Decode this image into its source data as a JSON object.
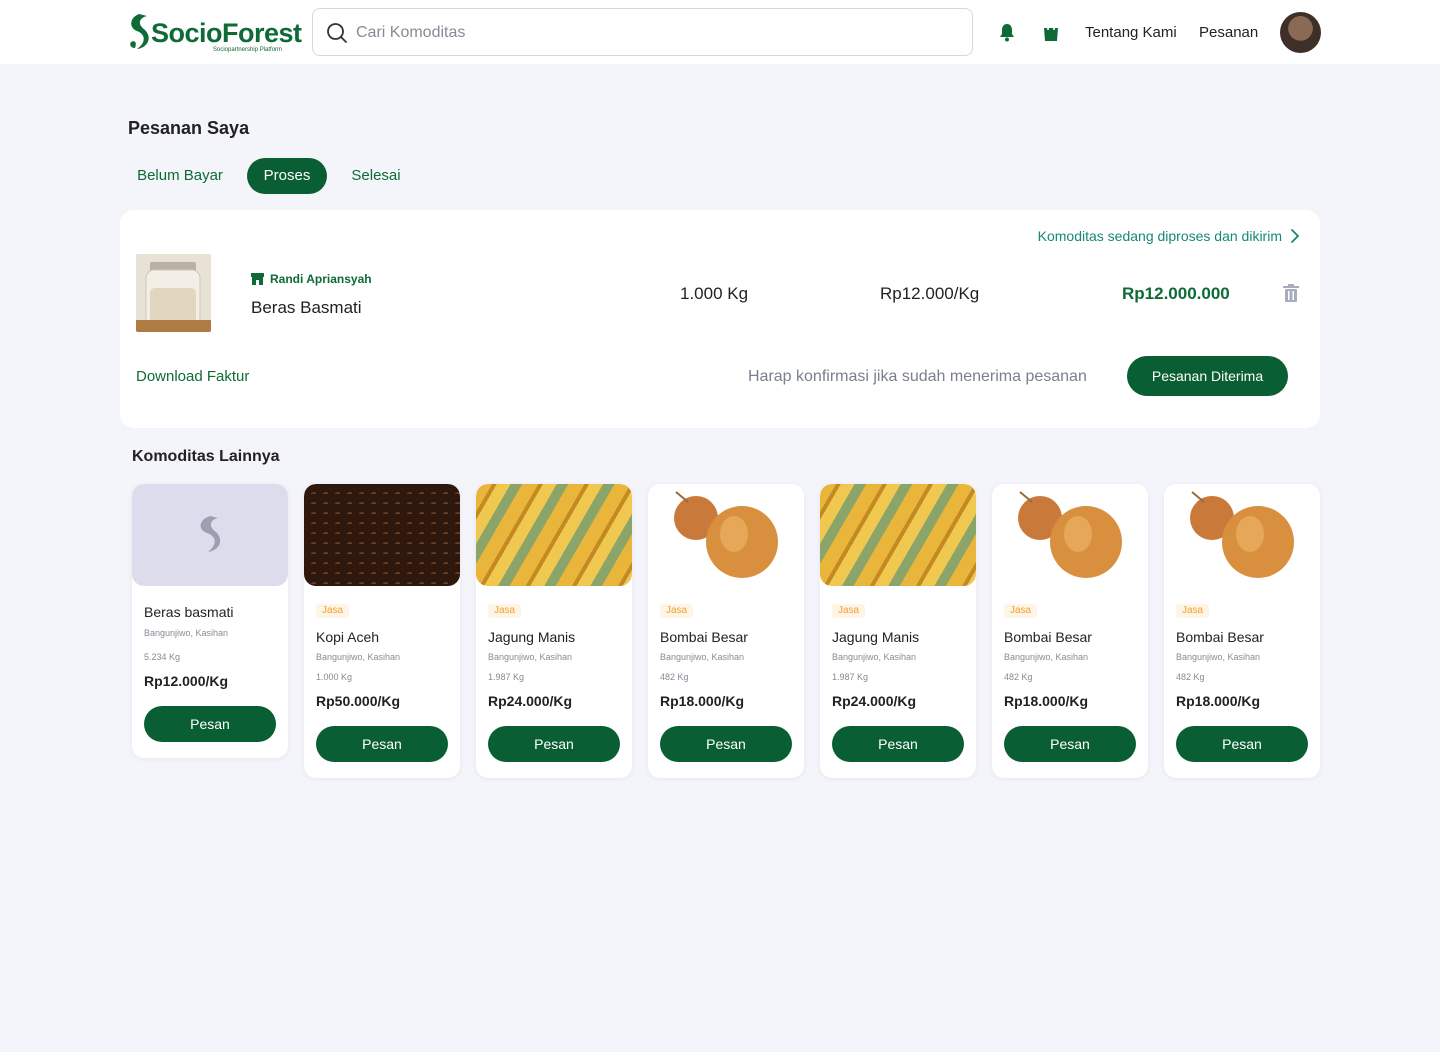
{
  "brand": {
    "name": "SocioForest",
    "tagline": "Sociopartnership Platform",
    "color": "#0e6b36"
  },
  "search": {
    "placeholder": "Cari Komoditas"
  },
  "nav": {
    "about": "Tentang Kami",
    "orders": "Pesanan"
  },
  "page": {
    "title": "Pesanan Saya"
  },
  "tabs": [
    {
      "label": "Belum Bayar",
      "active": false
    },
    {
      "label": "Proses",
      "active": true
    },
    {
      "label": "Selesai",
      "active": false
    }
  ],
  "order": {
    "status_text": "Komoditas sedang diproses dan dikirim",
    "seller": "Randi Apriansyah",
    "product": "Beras Basmati",
    "quantity": "1.000 Kg",
    "unit_price": "Rp12.000/Kg",
    "total": "Rp12.000.000",
    "download_label": "Download Faktur",
    "confirm_hint": "Harap konfirmasi jika sudah menerima pesanan",
    "received_button": "Pesanan Diterima"
  },
  "other": {
    "title": "Komoditas Lainnya",
    "items": [
      {
        "tag": "",
        "name": "Beras basmati",
        "location": "Bangunjiwo, Kasihan",
        "stock": "5.234 Kg",
        "price": "Rp12.000/Kg",
        "button": "Pesan",
        "image": "placeholder"
      },
      {
        "tag": "Jasa",
        "name": "Kopi Aceh",
        "location": "Bangunjiwo, Kasihan",
        "stock": "1.000 Kg",
        "price": "Rp50.000/Kg",
        "button": "Pesan",
        "image": "coffee"
      },
      {
        "tag": "Jasa",
        "name": "Jagung Manis",
        "location": "Bangunjiwo, Kasihan",
        "stock": "1.987 Kg",
        "price": "Rp24.000/Kg",
        "button": "Pesan",
        "image": "corn"
      },
      {
        "tag": "Jasa",
        "name": "Bombai Besar",
        "location": "Bangunjiwo, Kasihan",
        "stock": "482 Kg",
        "price": "Rp18.000/Kg",
        "button": "Pesan",
        "image": "onion"
      },
      {
        "tag": "Jasa",
        "name": "Jagung Manis",
        "location": "Bangunjiwo, Kasihan",
        "stock": "1.987 Kg",
        "price": "Rp24.000/Kg",
        "button": "Pesan",
        "image": "corn"
      },
      {
        "tag": "Jasa",
        "name": "Bombai Besar",
        "location": "Bangunjiwo, Kasihan",
        "stock": "482 Kg",
        "price": "Rp18.000/Kg",
        "button": "Pesan",
        "image": "onion"
      },
      {
        "tag": "Jasa",
        "name": "Bombai Besar",
        "location": "Bangunjiwo, Kasihan",
        "stock": "482 Kg",
        "price": "Rp18.000/Kg",
        "button": "Pesan",
        "image": "onion"
      }
    ]
  },
  "colors": {
    "primary": "#0a5e33",
    "accent_teal": "#16887a",
    "tag_orange": "#f0a030",
    "background": "#f4f4fb"
  }
}
